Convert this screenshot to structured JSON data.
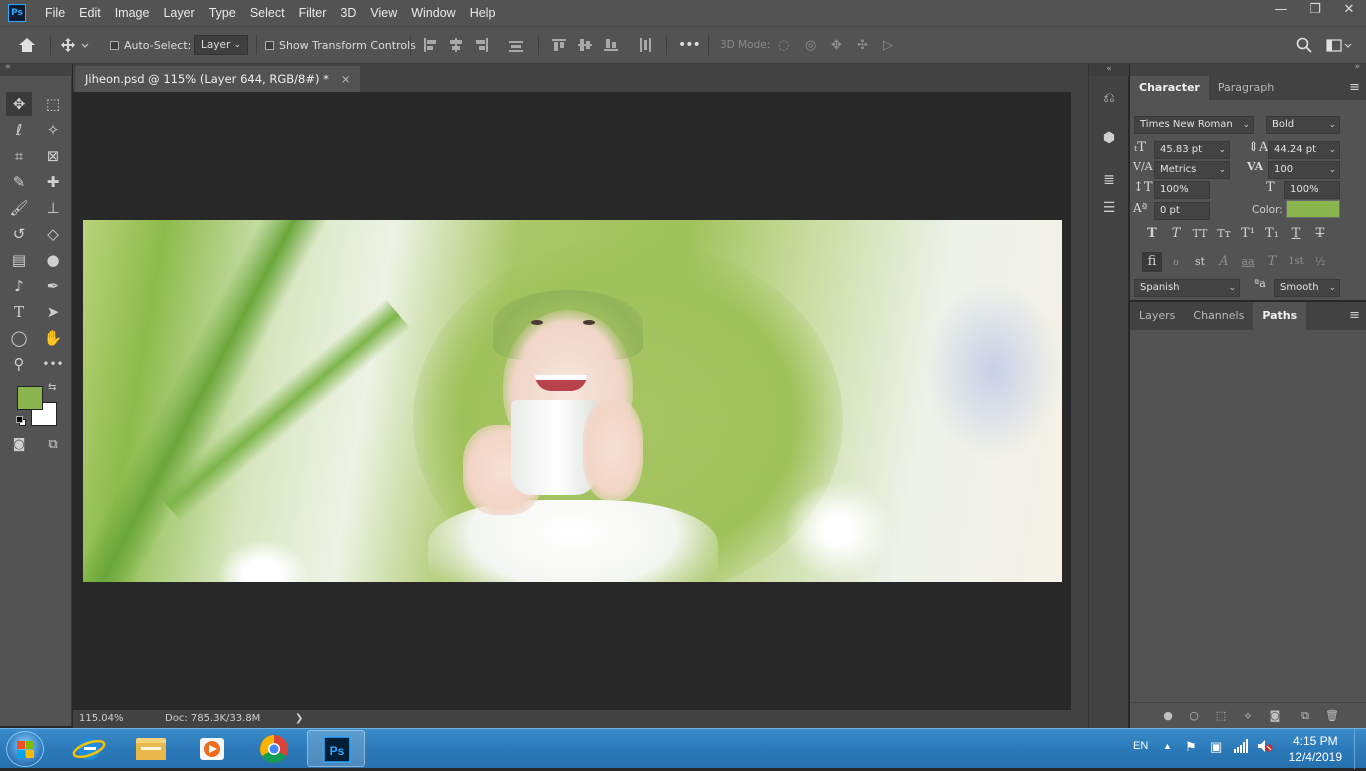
{
  "app": {
    "logo_text": "Ps",
    "menu": [
      "File",
      "Edit",
      "Image",
      "Layer",
      "Type",
      "Select",
      "Filter",
      "3D",
      "View",
      "Window",
      "Help"
    ],
    "window_controls": {
      "minimize": "—",
      "restore": "❐",
      "close": "✕"
    }
  },
  "options_bar": {
    "auto_select_label": "Auto-Select:",
    "auto_select_checked": false,
    "auto_select_target": "Layer",
    "show_transform_label": "Show Transform Controls",
    "show_transform_checked": false,
    "more_label": "•••",
    "mode_3d_label": "3D Mode:"
  },
  "document": {
    "tab_title": "Jiheon.psd @ 115% (Layer 644, RGB/8#) *",
    "close": "×",
    "zoom": "115.04%",
    "doc_size": "Doc: 785.3K/33.8M",
    "status_arrow": "❯"
  },
  "tools": {
    "foreground_color": "#8ab54f",
    "background_color": "#ffffff"
  },
  "character_panel": {
    "tabs": [
      "Character",
      "Paragraph"
    ],
    "active_tab": "Character",
    "font_family": "Times New Roman",
    "font_style": "Bold",
    "font_size": "45.83 pt",
    "leading": "44.24 pt",
    "kerning": "Metrics",
    "tracking": "100",
    "vertical_scale": "100%",
    "horizontal_scale": "100%",
    "baseline_shift": "0 pt",
    "color_label": "Color:",
    "color": "#8ab54f",
    "type_buttons": [
      "T",
      "T",
      "TT",
      "Tт",
      "T¹",
      "T₁",
      "T",
      "T"
    ],
    "opentype_buttons": [
      "fi",
      "ℴ",
      "st",
      "A",
      "aa",
      "T",
      "1st",
      "½"
    ],
    "language": "Spanish",
    "antialias": "Smooth"
  },
  "layers_panel": {
    "tabs": [
      "Layers",
      "Channels",
      "Paths"
    ],
    "active_tab": "Paths"
  },
  "taskbar": {
    "language": "EN",
    "time": "4:15 PM",
    "date": "12/4/2019",
    "apps": [
      "internet-explorer",
      "file-explorer",
      "media-player",
      "chrome",
      "photoshop"
    ],
    "active_app": "photoshop"
  }
}
